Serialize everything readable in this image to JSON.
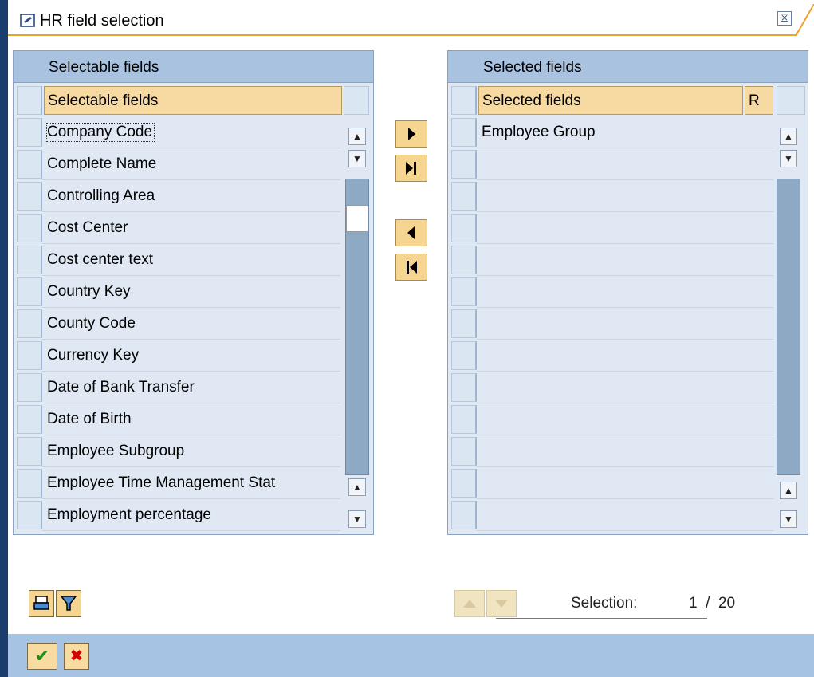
{
  "window": {
    "title": "HR field selection",
    "close_symbol": "☒"
  },
  "left_panel": {
    "header": "Selectable fields",
    "column_header": "Selectable fields",
    "rows": [
      "Company Code",
      "Complete Name",
      "Controlling Area",
      "Cost Center",
      "Cost center text",
      "Country Key",
      "County Code",
      "Currency Key",
      "Date of Bank Transfer",
      "Date of Birth",
      "Employee Subgroup",
      "Employee Time Management Stat",
      "Employment percentage"
    ]
  },
  "right_panel": {
    "header": "Selected fields",
    "column_header": "Selected fields",
    "column_r": "R",
    "rows": [
      "Employee Group",
      "",
      "",
      "",
      "",
      "",
      "",
      "",
      "",
      "",
      "",
      "",
      ""
    ]
  },
  "middle_buttons": {
    "add_one": "▶",
    "add_all": "▶|",
    "remove_one": "◀",
    "remove_all": "|◀"
  },
  "selection": {
    "label": "Selection:",
    "value": "1  /  20",
    "current": 1,
    "total": 20
  },
  "icons": {
    "title": "window-dialog-icon",
    "sort_up": "triangle-up-icon",
    "sort_down": "triangle-down-icon",
    "print": "print-icon",
    "filter": "filter-icon",
    "ok": "checkmark-icon",
    "cancel": "cross-icon"
  },
  "colors": {
    "header_blue": "#a9c2e0",
    "panel_bg": "#dfe8f3",
    "column_header": "#f7d9a2",
    "button_yellow": "#f5d590",
    "footer_blue": "#a7c3e3",
    "accent_orange": "#f0a030"
  }
}
